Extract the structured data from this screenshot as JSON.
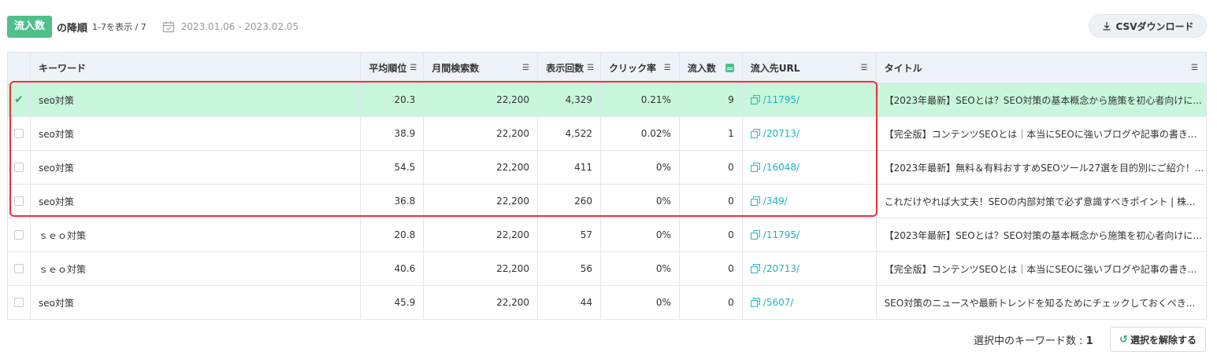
{
  "header": {
    "sort_badge": "流入数",
    "sort_suffix": "の降順",
    "range": "1-7を表示 / 7",
    "date_range": "2023.01.06 - 2023.02.05",
    "csv_button": "CSVダウンロード"
  },
  "table": {
    "columns": {
      "keyword": "キーワード",
      "avg_rank": "平均順位",
      "search_volume": "月間検索数",
      "impressions": "表示回数",
      "ctr": "クリック率",
      "inflow": "流入数",
      "url": "流入先URL",
      "title": "タイトル"
    },
    "rows": [
      {
        "keyword": "seo対策",
        "avg_rank": "20.3",
        "search_volume": "22,200",
        "impressions": "4,329",
        "ctr": "0.21%",
        "inflow": "9",
        "url": "/11795/",
        "title": "【2023年最新】SEOとは？SEO対策の基本概念から施策を初心者向けに...",
        "selected": true
      },
      {
        "keyword": "seo対策",
        "avg_rank": "38.9",
        "search_volume": "22,200",
        "impressions": "4,522",
        "ctr": "0.02%",
        "inflow": "1",
        "url": "/20713/",
        "title": "【完全版】コンテンツSEOとは｜本当にSEOに強いブログや記事の書き...",
        "selected": false
      },
      {
        "keyword": "seo対策",
        "avg_rank": "54.5",
        "search_volume": "22,200",
        "impressions": "411",
        "ctr": "0%",
        "inflow": "0",
        "url": "/16048/",
        "title": "【2023年最新】無料＆有料おすすめSEOツール27選を目的別にご紹介！...",
        "selected": false
      },
      {
        "keyword": "seo対策",
        "avg_rank": "36.8",
        "search_volume": "22,200",
        "impressions": "260",
        "ctr": "0%",
        "inflow": "0",
        "url": "/349/",
        "title": "これだけやれば大丈夫！SEOの内部対策で必ず意識すべきポイント | 株...",
        "selected": false
      },
      {
        "keyword": "ｓｅｏ対策",
        "avg_rank": "20.8",
        "search_volume": "22,200",
        "impressions": "57",
        "ctr": "0%",
        "inflow": "0",
        "url": "/11795/",
        "title": "【2023年最新】SEOとは？SEO対策の基本概念から施策を初心者向けに...",
        "selected": false
      },
      {
        "keyword": "ｓｅｏ対策",
        "avg_rank": "40.6",
        "search_volume": "22,200",
        "impressions": "56",
        "ctr": "0%",
        "inflow": "0",
        "url": "/20713/",
        "title": "【完全版】コンテンツSEOとは｜本当にSEOに強いブログや記事の書き...",
        "selected": false
      },
      {
        "keyword": "seo対策",
        "avg_rank": "45.9",
        "search_volume": "22,200",
        "impressions": "44",
        "ctr": "0%",
        "inflow": "0",
        "url": "/5607/",
        "title": "SEO対策のニュースや最新トレンドを知るためにチェックしておくべき...",
        "selected": false
      }
    ]
  },
  "footer": {
    "selected_label": "選択中のキーワード数 : ",
    "selected_count": "1",
    "clear_button": "選択を解除する"
  },
  "colors": {
    "accent": "#4fbf8b",
    "selected_row": "#c8f7db",
    "link": "#1ab4c7",
    "highlight": "#e8333b"
  }
}
